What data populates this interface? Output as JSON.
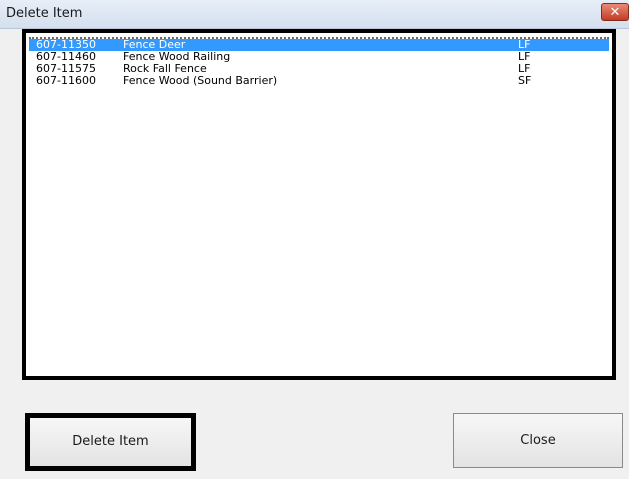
{
  "window": {
    "title": "Delete Item",
    "close_glyph": "✕"
  },
  "items": [
    {
      "code": "607-11350",
      "description": "Fence Deer",
      "unit": "LF",
      "selected": true
    },
    {
      "code": "607-11460",
      "description": "Fence Wood Railing",
      "unit": "LF",
      "selected": false
    },
    {
      "code": "607-11575",
      "description": "Rock Fall Fence",
      "unit": "LF",
      "selected": false
    },
    {
      "code": "607-11600",
      "description": "Fence Wood (Sound Barrier)",
      "unit": "SF",
      "selected": false
    }
  ],
  "buttons": {
    "delete_label": "Delete Item",
    "close_label": "Close"
  },
  "colors": {
    "selection": "#3399ff",
    "title_close": "#c23c25"
  }
}
